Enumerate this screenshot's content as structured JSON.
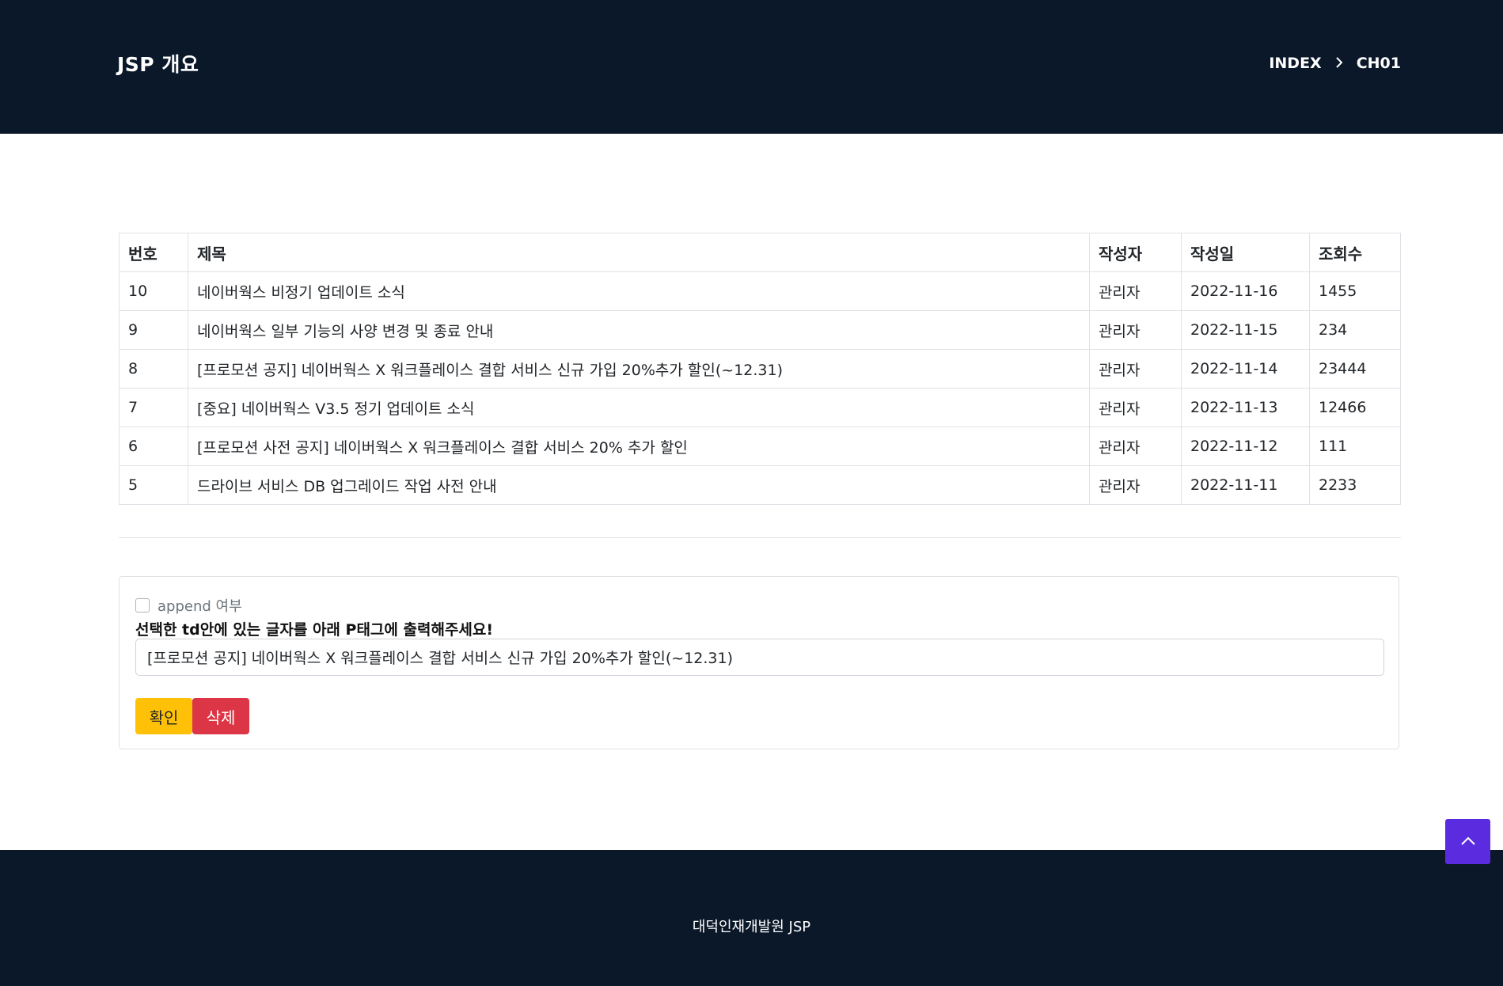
{
  "header": {
    "title": "JSP 개요",
    "breadcrumb": [
      "INDEX",
      "CH01"
    ],
    "background_color": "#0b1829"
  },
  "table": {
    "columns": [
      "번호",
      "제목",
      "작성자",
      "작성일",
      "조회수"
    ],
    "rows": [
      {
        "no": "10",
        "title": "네이버웍스 비정기 업데이트 소식",
        "writer": "관리자",
        "date": "2022-11-16",
        "hits": "1455"
      },
      {
        "no": "9",
        "title": "네이버웍스 일부 기능의 사양 변경 및 종료 안내",
        "writer": "관리자",
        "date": "2022-11-15",
        "hits": "234"
      },
      {
        "no": "8",
        "title": "[프로모션 공지] 네이버웍스 X 워크플레이스 결합 서비스 신규 가입 20%추가 할인(~12.31)",
        "writer": "관리자",
        "date": "2022-11-14",
        "hits": "23444"
      },
      {
        "no": "7",
        "title": "[중요] 네이버웍스 V3.5 정기 업데이트 소식",
        "writer": "관리자",
        "date": "2022-11-13",
        "hits": "12466"
      },
      {
        "no": "6",
        "title": "[프로모션 사전 공지] 네이버웍스 X 워크플레이스 결합 서비스 20% 추가 할인",
        "writer": "관리자",
        "date": "2022-11-12",
        "hits": "111"
      },
      {
        "no": "5",
        "title": "드라이브 서비스 DB 업그레이드 작업 사전 안내",
        "writer": "관리자",
        "date": "2022-11-11",
        "hits": "2233"
      }
    ]
  },
  "form": {
    "append_label": "append 여부",
    "append_checked": false,
    "instruction": "선택한 td안에 있는 글자를 아래 P태그에 출력해주세요!",
    "output_value": "[프로모션 공지] 네이버웍스 X 워크플레이스 결합 서비스 신규 가입 20%추가 할인(~12.31)",
    "confirm_label": "확인",
    "delete_label": "삭제",
    "confirm_color": "#ffc107",
    "delete_color": "#dc3545"
  },
  "footer": {
    "text": "대덕인재개발원 JSP"
  },
  "scroll_top": {
    "icon": "chevron-up-icon",
    "color": "#5b2be0"
  }
}
